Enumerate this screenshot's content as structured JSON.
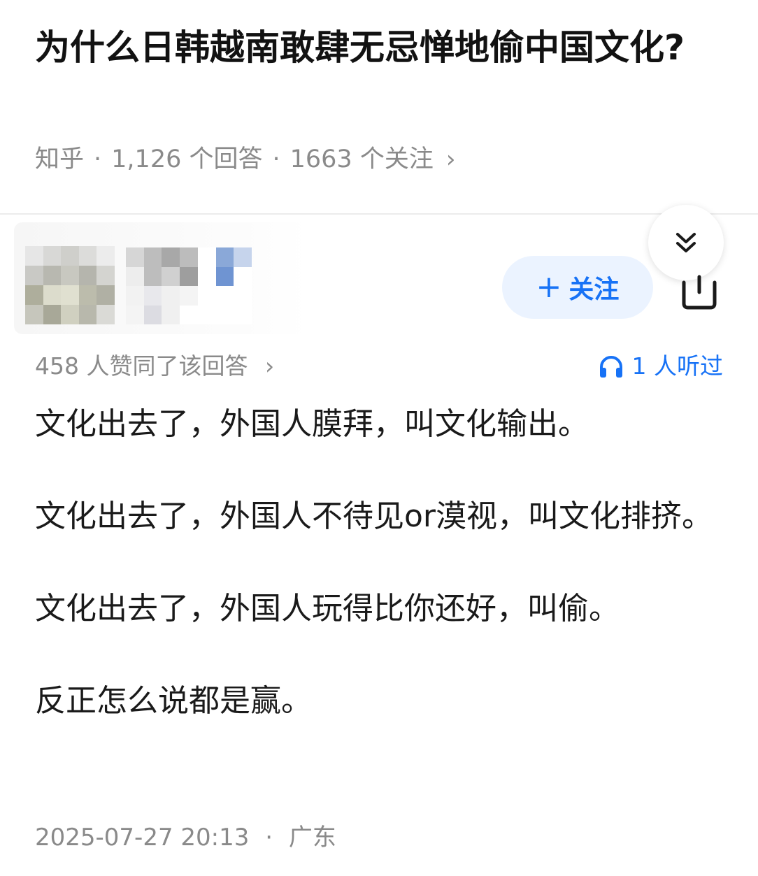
{
  "question": {
    "title": "为什么日韩越南敢肆无忌惮地偷中国文化?",
    "source": "知乎",
    "answers_count": "1,126 个回答",
    "followers_count": "1663 个关注",
    "chevron": "›"
  },
  "author": {
    "name": "",
    "avatar_icon": "pixelated-avatar",
    "follow_label": "关注",
    "follow_plus": "+"
  },
  "stats": {
    "votes_text": "458 人赞同了该回答",
    "votes_chevron": "›",
    "listened_text": "1 人听过",
    "listened_icon": "headphones-icon"
  },
  "answer": {
    "paragraphs": [
      "文化出去了，外国人膜拜，叫文化输出。",
      "文化出去了，外国人不待见or漠视，叫文化排挤。",
      "文化出去了，外国人玩得比你还好，叫偷。",
      "反正怎么说都是赢。"
    ]
  },
  "footer": {
    "datetime": "2025-07-27 20:13",
    "location": "广东"
  },
  "colors": {
    "accent": "#1772f6",
    "follow_bg": "#ebf3ff",
    "meta_gray": "#8a8a8a",
    "text": "#1a1a1a"
  }
}
